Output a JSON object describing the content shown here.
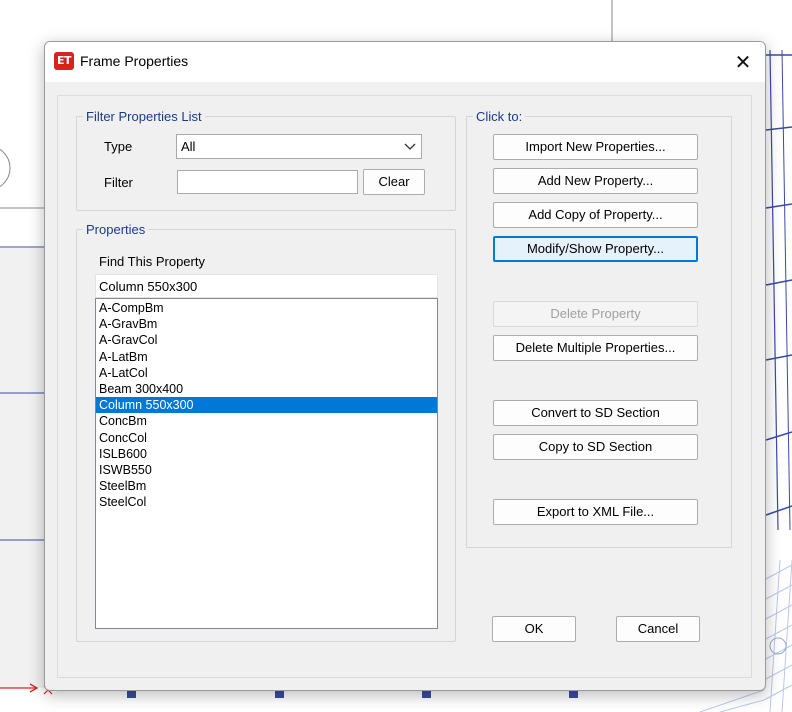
{
  "window": {
    "title": "Frame Properties",
    "app_icon_label": "ET",
    "close_glyph": "✕"
  },
  "filter_group": {
    "legend": "Filter Properties List",
    "type_label": "Type",
    "type_value": "All",
    "filter_label": "Filter",
    "filter_value": "",
    "clear_label": "Clear"
  },
  "properties_group": {
    "legend": "Properties",
    "find_label": "Find This Property",
    "find_value": "Column 550x300",
    "items": [
      "A-CompBm",
      "A-GravBm",
      "A-GravCol",
      "A-LatBm",
      "A-LatCol",
      "Beam 300x400",
      "Column 550x300",
      "ConcBm",
      "ConcCol",
      "ISLB600",
      "ISWB550",
      "SteelBm",
      "SteelCol"
    ],
    "selected_item": "Column 550x300"
  },
  "click_group": {
    "legend": "Click to:",
    "import_label": "Import New Properties...",
    "add_new_label": "Add New Property...",
    "add_copy_label": "Add Copy of Property...",
    "modify_label": "Modify/Show Property...",
    "delete_label": "Delete Property",
    "delete_multiple_label": "Delete Multiple Properties...",
    "convert_sd_label": "Convert to SD Section",
    "copy_sd_label": "Copy to SD Section",
    "export_xml_label": "Export to XML File..."
  },
  "footer": {
    "ok_label": "OK",
    "cancel_label": "Cancel"
  },
  "colors": {
    "accent": "#0078d7",
    "legend_text": "#1a3a8c",
    "app_icon": "#d9221e",
    "axis_arrow": "#e02020"
  },
  "icons": {
    "app": "etabs-app-icon",
    "close": "close-icon",
    "dropdown": "chevron-down-icon"
  }
}
